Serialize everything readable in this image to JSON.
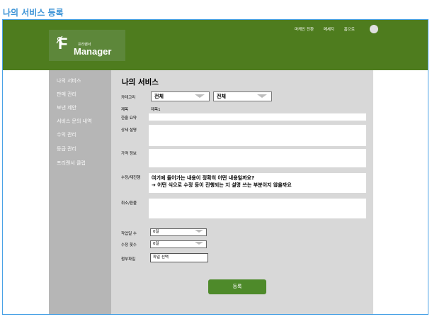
{
  "page": {
    "caption": "나의 서비스 등록"
  },
  "header": {
    "logo": {
      "f": "F",
      "korean": "프리랜서",
      "manager": "Manager"
    },
    "nav": [
      "마케인 전환",
      "메세지",
      "홈으로"
    ],
    "bg_color": "#4e7c1e"
  },
  "sidebar": {
    "items": [
      {
        "label": "나의 서비스"
      },
      {
        "label": "판매 관리"
      },
      {
        "label": "보낸 제안"
      },
      {
        "label": "서비스 문의 내역"
      },
      {
        "label": "수익 관리"
      },
      {
        "label": "등급 관리"
      },
      {
        "label": "프리랜서 클럽"
      }
    ]
  },
  "main": {
    "title": "나의 서비스",
    "category": {
      "label": "카테고리",
      "select1": "전체",
      "select2": "전체"
    },
    "subject": {
      "label": "제목",
      "value": "제목1"
    },
    "summary": {
      "label": "한줄 요약"
    },
    "description": {
      "label": "상세 설명"
    },
    "price": {
      "label": "가격 정보"
    },
    "revision": {
      "label": "수정/재진행",
      "note_line1": "여기에 들어가는 내용이 정확히 어떤 내용일까요?",
      "note_line2": "➔ 어떤 식으로 수정 등이 진행되는 지 설명 쓰는 부분이지 않을까요"
    },
    "refund": {
      "label": "취소/환불"
    },
    "workdays": {
      "label": "작업일 수",
      "value": "0일"
    },
    "revisions_count": {
      "label": "수정 횟수",
      "value": "0일"
    },
    "attachment": {
      "label": "첨부파일",
      "button": "파일 선택"
    },
    "submit": "등록"
  }
}
